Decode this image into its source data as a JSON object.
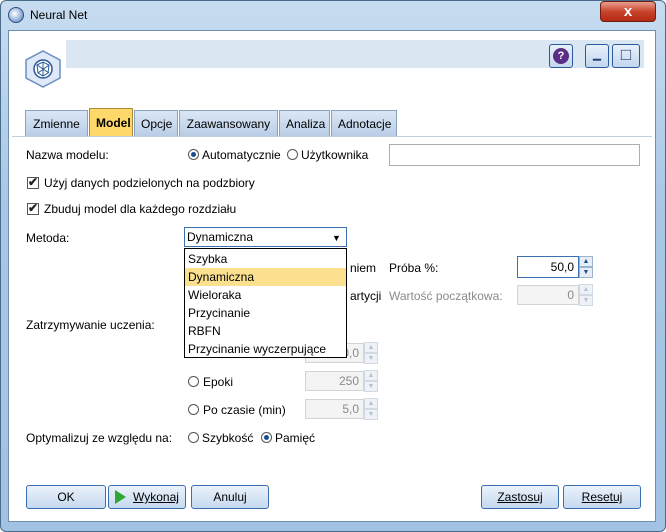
{
  "window": {
    "title": "Neural Net",
    "close_glyph": "x"
  },
  "header": {
    "help_glyph": "?",
    "minimize_glyph": "▁",
    "maximize_glyph": "□"
  },
  "tabs": [
    {
      "label": "Zmienne"
    },
    {
      "label": "Model",
      "active": true
    },
    {
      "label": "Opcje"
    },
    {
      "label": "Zaawansowany"
    },
    {
      "label": "Analiza"
    },
    {
      "label": "Adnotacje"
    }
  ],
  "model_name": {
    "label": "Nazwa modelu:",
    "option_auto": "Automatycznie",
    "option_user": "Użytkownika",
    "selected": "Automatycznie",
    "value": ""
  },
  "checkboxes": {
    "use_partitioned": {
      "label": "Użyj danych podzielonych na podzbiory",
      "checked": true
    },
    "split_models": {
      "label": "Zbuduj model dla każdego rozdziału",
      "checked": true
    }
  },
  "method": {
    "label": "Metoda:",
    "value": "Dynamiczna",
    "options": [
      "Szybka",
      "Dynamiczna",
      "Wieloraka",
      "Przycinanie",
      "RBFN",
      "Przycinanie wyczerpujące"
    ],
    "highlighted": "Dynamiczna"
  },
  "sampling": {
    "partial_label_1": "niem",
    "partial_label_2": "artycji",
    "sample_label": "Próba %:",
    "sample_value": "50,0",
    "seed_label": "Wartość początkowa:",
    "seed_value": "0"
  },
  "stopping": {
    "label": "Zatrzymywanie uczenia:",
    "hidden_value": "0,0",
    "epochs_label": "Epoki",
    "epochs_value": "250",
    "time_label": "Po czasie (min)",
    "time_value": "5,0"
  },
  "optimize": {
    "label": "Optymalizuj ze względu na:",
    "option_speed": "Szybkość",
    "option_memory": "Pamięć",
    "selected": "Pamięć"
  },
  "buttons": {
    "ok": "OK",
    "run": "Wykonaj",
    "cancel": "Anuluj",
    "apply": "Zastosuj",
    "reset": "Resetuj"
  },
  "colors": {
    "active_tab": "#ffd86a",
    "highlight": "#fbe08f",
    "run_icon": "#2fa833"
  }
}
